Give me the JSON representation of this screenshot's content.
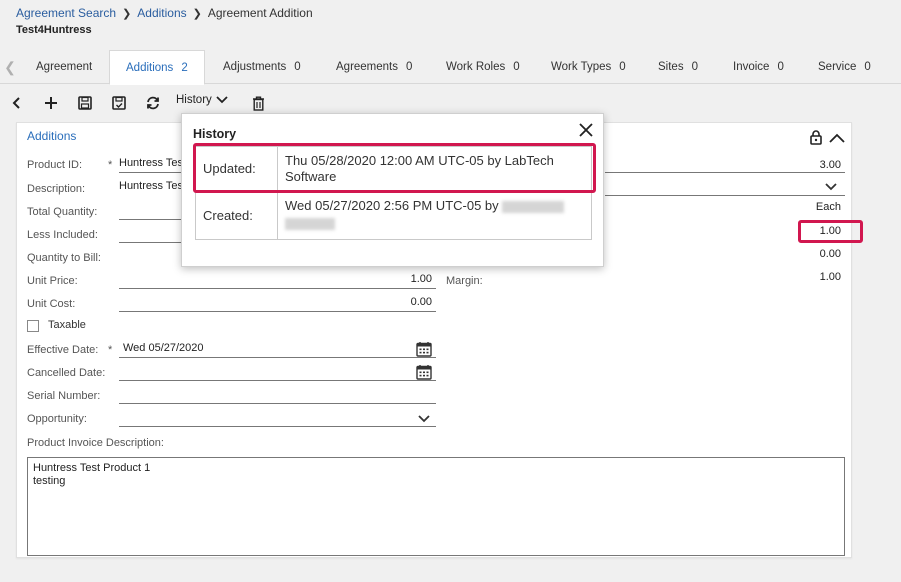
{
  "breadcrumb": {
    "items": [
      "Agreement Search",
      "Additions"
    ],
    "current": "Agreement Addition"
  },
  "record_title": "Test4Huntress",
  "tabs": [
    {
      "label": "Agreement",
      "count": ""
    },
    {
      "label": "Additions",
      "count": "2"
    },
    {
      "label": "Adjustments",
      "count": "0"
    },
    {
      "label": "Agreements",
      "count": "0"
    },
    {
      "label": "Work Roles",
      "count": "0"
    },
    {
      "label": "Work Types",
      "count": "0"
    },
    {
      "label": "Sites",
      "count": "0"
    },
    {
      "label": "Invoice",
      "count": "0"
    },
    {
      "label": "Service",
      "count": "0"
    }
  ],
  "toolbar": {
    "history_label": "History"
  },
  "section": {
    "title": "Additions"
  },
  "form": {
    "product_id_label": "Product ID:",
    "product_id_value": "Huntress Test Product 1",
    "description_label": "Description:",
    "description_value": "Huntress Test Product 1",
    "total_quantity_label": "Total Quantity:",
    "less_included_label": "Less Included:",
    "quantity_to_bill_label": "Quantity to Bill:",
    "unit_price_label": "Unit Price:",
    "unit_price_value": "1.00",
    "unit_cost_label": "Unit Cost:",
    "unit_cost_value": "0.00",
    "taxable_label": "Taxable",
    "effective_date_label": "Effective Date:",
    "effective_date_value": "Wed 05/27/2020",
    "cancelled_date_label": "Cancelled Date:",
    "serial_number_label": "Serial Number:",
    "opportunity_label": "Opportunity:",
    "invoice_description_label": "Product Invoice Description:",
    "invoice_description_value": "Huntress Test Product 1\ntesting",
    "margin_label": "Margin:",
    "required_mark": "*",
    "right_values": {
      "quantity": "3.00",
      "uom": "Each",
      "less_included": "1.00",
      "quantity_to_bill": "0.00",
      "margin": "1.00"
    }
  },
  "history_popup": {
    "title": "History",
    "rows": [
      {
        "label": "Updated:",
        "value": "Thu 05/28/2020 12:00 AM UTC-05 by LabTech Software"
      },
      {
        "label": "Created:",
        "value": "Wed 05/27/2020 2:56 PM UTC-05 by"
      }
    ]
  },
  "colors": {
    "accent": "#2a6ebb",
    "highlight": "#d1174f"
  }
}
